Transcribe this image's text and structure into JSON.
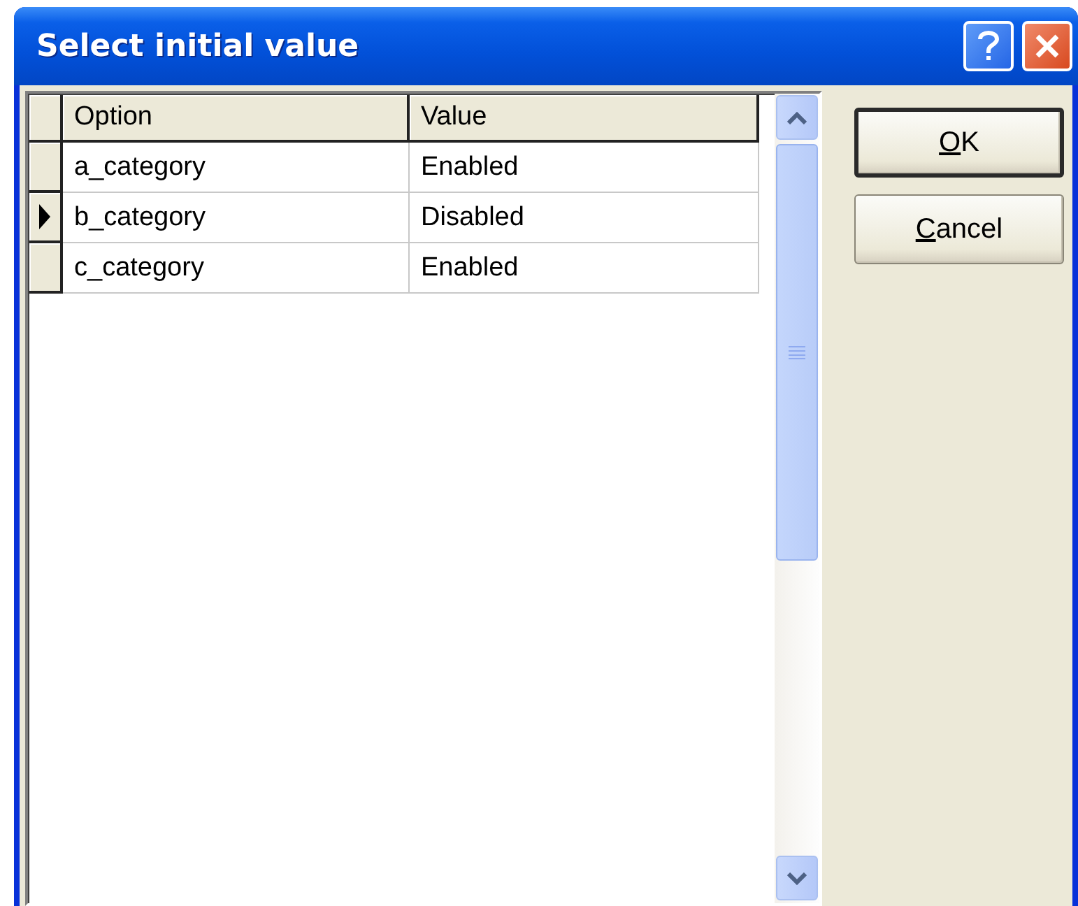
{
  "window": {
    "title": "Select initial value"
  },
  "table": {
    "columns": [
      "Option",
      "Value"
    ],
    "rows": [
      {
        "option": "a_category",
        "value": "Enabled",
        "selected": false
      },
      {
        "option": "b_category",
        "value": "Disabled",
        "selected": true
      },
      {
        "option": "c_category",
        "value": "Enabled",
        "selected": false
      }
    ]
  },
  "buttons": [
    {
      "label": "OK",
      "default": true,
      "mnemonic": true
    },
    {
      "label": "Cancel",
      "default": false,
      "mnemonic": true
    }
  ]
}
